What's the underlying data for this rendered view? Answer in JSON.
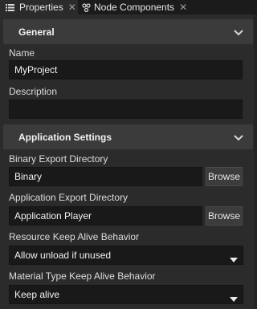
{
  "tabs": [
    {
      "label": "Properties",
      "icon": "list-icon",
      "active": true
    },
    {
      "label": "Node Components",
      "icon": "node-components-icon",
      "active": false
    }
  ],
  "sections": {
    "general": {
      "title": "General",
      "name_label": "Name",
      "name_value": "MyProject",
      "description_label": "Description",
      "description_value": ""
    },
    "application_settings": {
      "title": "Application Settings",
      "binary_dir_label": "Binary Export Directory",
      "binary_dir_value": "Binary",
      "app_dir_label": "Application Export Directory",
      "app_dir_value": "Application Player",
      "browse_label": "Browse",
      "resource_label": "Resource Keep Alive Behavior",
      "resource_value": "Allow unload if unused",
      "material_label": "Material Type Keep Alive Behavior",
      "material_value": "Keep alive"
    }
  },
  "colors": {
    "panel_bg": "#2b2b2b",
    "header_bg": "#3b3b3b",
    "input_bg": "#191919"
  }
}
